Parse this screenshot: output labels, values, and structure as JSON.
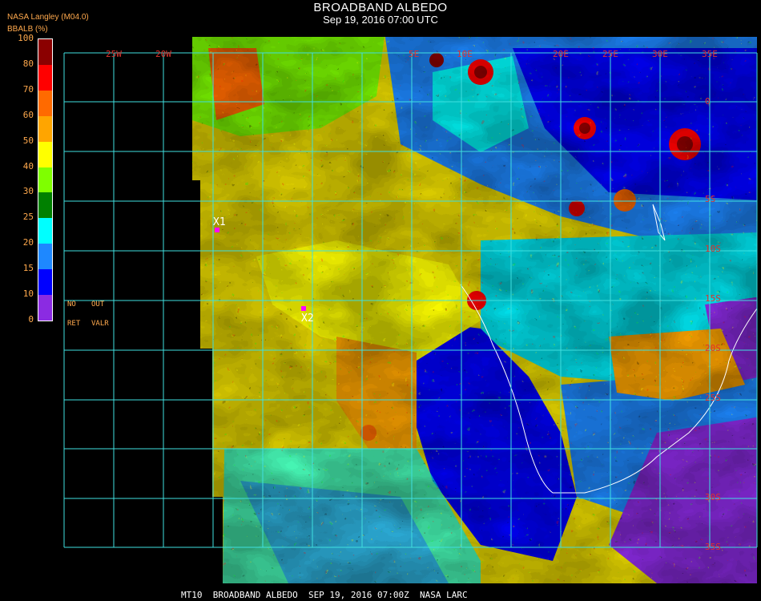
{
  "title": "BROADBAND ALBEDO",
  "subtitle": "Sep 19, 2016 07:00 UTC",
  "producer": "NASA Langley (M04.0)",
  "unit_label": "BBALB (%)",
  "legend": {
    "ticks": [
      "100",
      "80",
      "70",
      "60",
      "50",
      "40",
      "30",
      "25",
      "20",
      "15",
      "10",
      "0"
    ],
    "colors": [
      "#8b2be2",
      "#0000ff",
      "#1e88ff",
      "#00ffff",
      "#008000",
      "#7fff00",
      "#ffff00",
      "#ffa500",
      "#ff6a00",
      "#ff0000",
      "#8b0000"
    ],
    "no_ret": [
      "NO",
      "RET"
    ],
    "out_valr": [
      "OUT",
      "VALR"
    ]
  },
  "grid_labels": {
    "longitudes": [
      "25W",
      "20W",
      "5E",
      "10E",
      "20E",
      "25E",
      "30E",
      "35E"
    ],
    "latitudes": [
      "0",
      "5S",
      "10S",
      "15S",
      "20S",
      "25S",
      "30S",
      "35S"
    ]
  },
  "markers": [
    {
      "label": "X1",
      "color": "#ff00ff"
    },
    {
      "label": "X2",
      "color": "#ff00ff"
    }
  ],
  "colors": {
    "grid": "#40e0e0",
    "coast": "#ffffff",
    "grid_label": "#e0322e",
    "legend_text": "#ffa94d"
  },
  "footer": "MT10  BROADBAND ALBEDO  SEP 19, 2016 07:00Z  NASA LARC"
}
